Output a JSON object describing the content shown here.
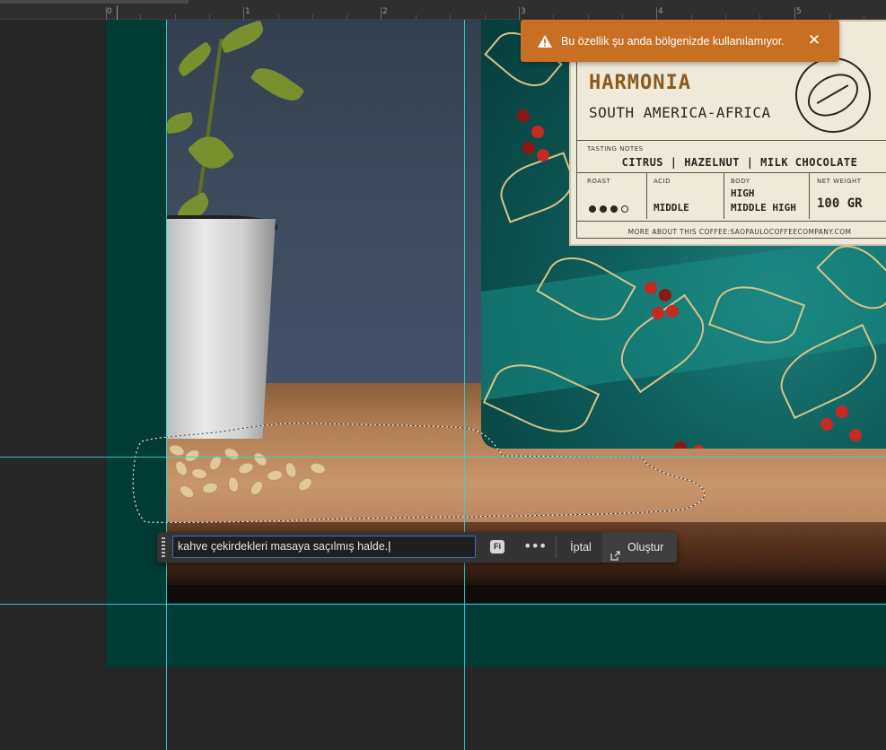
{
  "ruler": {
    "labels": [
      "0",
      "1",
      "2",
      "3",
      "4",
      "5"
    ]
  },
  "notification": {
    "message": "Bu özellik şu anda bölgenizde kullanılamıyor.",
    "close_label": "✕",
    "warning_icon": "warning-triangle-icon",
    "color": "#c86f23"
  },
  "product_label": {
    "brand": "HARMONIA",
    "region": "SOUTH AMERICA-AFRICA",
    "tasting_notes_caption": "TASTING NOTES",
    "tasting_notes": "CITRUS | HAZELNUT | MILK CHOCOLATE",
    "roast_caption": "ROAST",
    "roast_level": 3,
    "roast_max": 4,
    "acid_caption": "ACID",
    "acid_value": "MIDDLE",
    "body_caption": "BODY",
    "body_value_1": "HIGH",
    "body_value_2": "MIDDLE HIGH",
    "weight_caption": "NET WEIGHT",
    "weight_value": "100 GR",
    "footer": "MORE ABOUT THIS COFFEE:SAOPAULOCOFFEECOMPANY.COM"
  },
  "taskbar": {
    "prompt_value": "kahve çekirdekleri masaya saçılmış halde.",
    "fi_badge": "Fi",
    "more_label": "•••",
    "cancel_label": "İptal",
    "create_label": "Oluştur"
  },
  "colors": {
    "artboard_bg": "#003b34",
    "guide": "#2fd6d1",
    "input_focus": "#3e6fb7"
  }
}
